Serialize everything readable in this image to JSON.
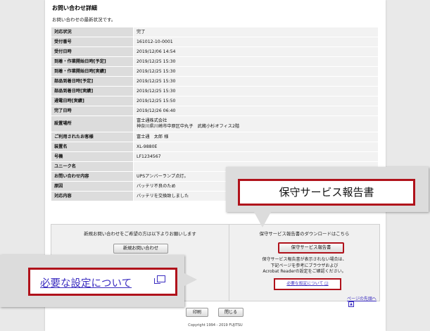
{
  "page": {
    "title": "お問い合わせ詳細",
    "subtitle": "お問い合わせの最新状況です。"
  },
  "details": [
    {
      "label": "対応状況",
      "value": "完了"
    },
    {
      "label": "受付番号",
      "value": "161012-10-0001"
    },
    {
      "label": "受付日時",
      "value": "2019/12/06 14:54"
    },
    {
      "label": "到着・作業開始日時[予定]",
      "value": "2019/12/25 15:30"
    },
    {
      "label": "到着・作業開始日時[実績]",
      "value": "2019/12/25 15:30"
    },
    {
      "label": "部品到着日時[予定]",
      "value": "2019/12/25 15:30"
    },
    {
      "label": "部品到着日時[実績]",
      "value": "2019/12/25 15:30"
    },
    {
      "label": "通電日時[実績]",
      "value": "2019/12/25 15:50"
    },
    {
      "label": "完了日時",
      "value": "2019/12/26 06:40"
    },
    {
      "label": "設置場所",
      "value": "富士通株式会社",
      "value2": "神奈川県川崎市中原区中丸子　武蔵小杉オフィス2階"
    },
    {
      "label": "ご利用されたお客様",
      "value": "富士通　太郎 様"
    },
    {
      "label": "装置名",
      "value": "XL-9880E"
    },
    {
      "label": "号機",
      "value": "LF1234567"
    },
    {
      "label": "ユニーク名",
      "value": ""
    },
    {
      "label": "お問い合わせ内容",
      "value": "UPSアンバーランプ点灯。"
    },
    {
      "label": "原因",
      "value": "バッテリ不良のため"
    },
    {
      "label": "対応内容",
      "value": "バッテリを交換致しました"
    }
  ],
  "new_inquiry": {
    "text": "新規お問い合わせをご希望の方は以下よりお願いします",
    "button": "新規お問い合わせ"
  },
  "report": {
    "text": "保守サービス報告書のダウンロードはこちら",
    "button": "保守サービス報告書",
    "note_line1": "保守サービス報告書が表示されない場合は、",
    "note_line2": "下記ページを参考にブラウザおよび",
    "note_line3": "Acrobat Readerの設定をご確認ください。",
    "settings_link": "必要な設定について"
  },
  "top_link": "ページの先頭へ",
  "footer": {
    "print_button": "印刷",
    "close_button": "閉じる",
    "copyright": "Copyright 1994 - 2019 FUJITSU"
  },
  "callouts": {
    "report_zoom": "保守サービス報告書",
    "settings_zoom": "必要な設定について"
  },
  "colors": {
    "highlight": "#b0121b",
    "link": "#3a2cc0",
    "label_bg": "#dcdcdc"
  }
}
